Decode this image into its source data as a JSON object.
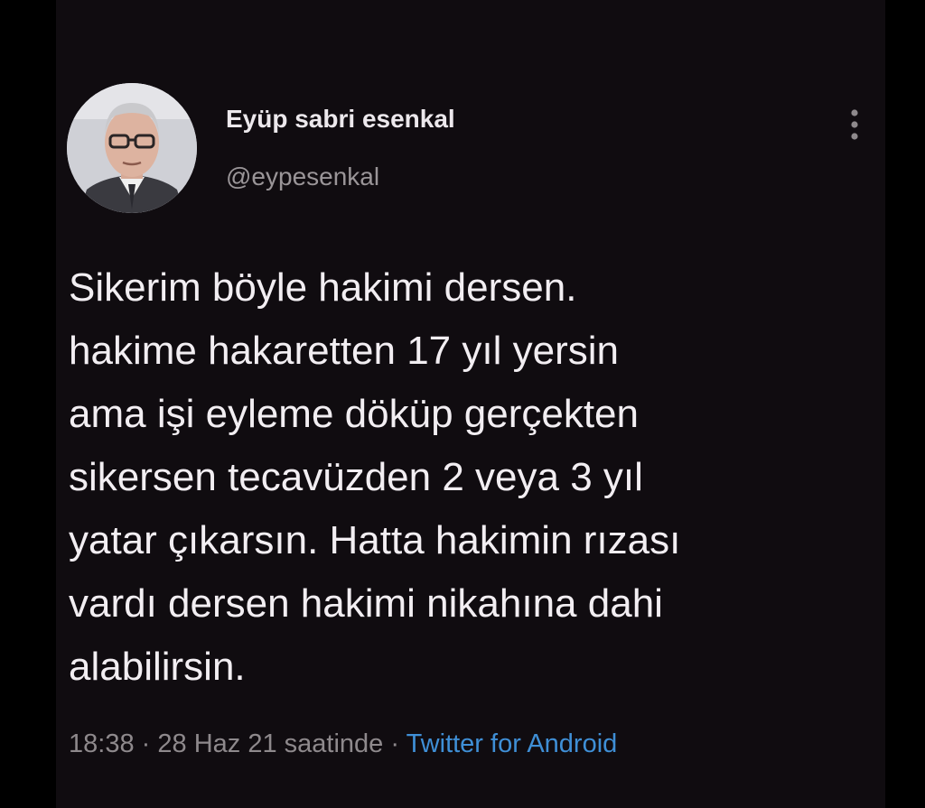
{
  "tweet": {
    "display_name": "Eyüp sabri esenkal",
    "handle": "@eypesenkal",
    "more_icon": "vertical-ellipsis-icon",
    "text_lines": [
      "Sikerim böyle hakimi dersen.",
      "hakime hakaretten 17 yıl yersin",
      "ama işi eyleme döküp gerçekten",
      "sikersen tecavüzden 2 veya 3 yıl",
      "yatar çıkarsın. Hatta hakimin rızası",
      "vardı dersen hakimi nikahına dahi",
      "alabilirsin."
    ],
    "time": "18:38",
    "date": "28 Haz 21 saatinde",
    "separator": "·",
    "source": "Twitter for Android"
  },
  "colors": {
    "background": "#100c10",
    "text": "#f2eef2",
    "muted": "#8e898c",
    "link": "#3f8fd6"
  }
}
